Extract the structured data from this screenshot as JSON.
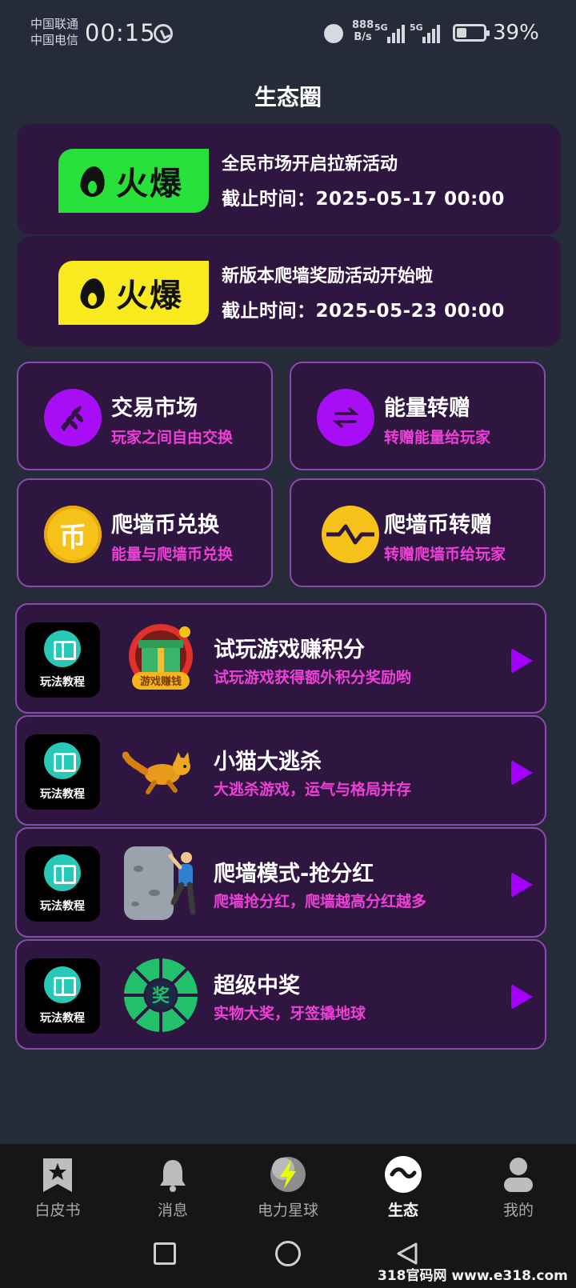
{
  "status_bar": {
    "carrier_1": "中国联通",
    "carrier_2": "中国电信",
    "time": "00:15",
    "net_speed_value": "888",
    "net_speed_unit": "B/s",
    "signal_1_label": "5G",
    "signal_2_label": "5G",
    "battery_percent": "39%",
    "battery_level": 0.39
  },
  "header": {
    "title": "生态圈"
  },
  "banners": [
    {
      "badge": "火爆",
      "badge_color": "#27e13a",
      "title": "全民市场开启拉新活动",
      "deadline": "截止时间：2025-05-17 00:00"
    },
    {
      "badge": "火爆",
      "badge_color": "#f9ea1f",
      "title": "新版本爬墙奖励活动开始啦",
      "deadline": "截止时间：2025-05-23 00:00"
    }
  ],
  "tiles": [
    {
      "title": "交易市场",
      "subtitle": "玩家之间自由交换",
      "icon": "leaf-icon",
      "icon_color": "#a80ef5"
    },
    {
      "title": "能量转赠",
      "subtitle": "转赠能量给玩家",
      "icon": "transfer-arrows-icon",
      "icon_color": "#a80ef5"
    },
    {
      "title": "爬墙币兑换",
      "subtitle": "能量与爬墙币兑换",
      "icon": "coin-icon",
      "icon_glyph": "币",
      "icon_color": "#f6c21a"
    },
    {
      "title": "爬墙币转赠",
      "subtitle": "转赠爬墙币给玩家",
      "icon": "coin-transfer-icon",
      "icon_color": "#f6c21a"
    }
  ],
  "games": [
    {
      "guide": "玩法教程",
      "title": "试玩游戏赚积分",
      "subtitle": "试玩游戏获得额外积分奖励哟",
      "art": "gift-box-art",
      "art_caption": "游戏赚钱"
    },
    {
      "guide": "玩法教程",
      "title": "小猫大逃杀",
      "subtitle": "大逃杀游戏，运气与格局并存",
      "art": "running-cat-art"
    },
    {
      "guide": "玩法教程",
      "title": "爬墙模式-抢分红",
      "subtitle": "爬墙抢分红，爬墙越高分红越多",
      "art": "climber-art"
    },
    {
      "guide": "玩法教程",
      "title": "超级中奖",
      "subtitle": "实物大奖，牙签撬地球",
      "art": "prize-wheel-art",
      "art_caption": "奖"
    }
  ],
  "bottom_nav": [
    {
      "label": "白皮书",
      "icon": "bookmark-star-icon",
      "active": false
    },
    {
      "label": "消息",
      "icon": "bell-icon",
      "active": false
    },
    {
      "label": "电力星球",
      "icon": "lightning-planet-icon",
      "active": false
    },
    {
      "label": "生态",
      "icon": "ecology-wave-icon",
      "active": true
    },
    {
      "label": "我的",
      "icon": "user-icon",
      "active": false
    }
  ],
  "colors": {
    "accent": "#a300ff",
    "subtitle": "#ee40d8",
    "card_bg": "#2e1640",
    "page_bg": "#252b38"
  },
  "watermark": "318官码网 www.e318.com"
}
